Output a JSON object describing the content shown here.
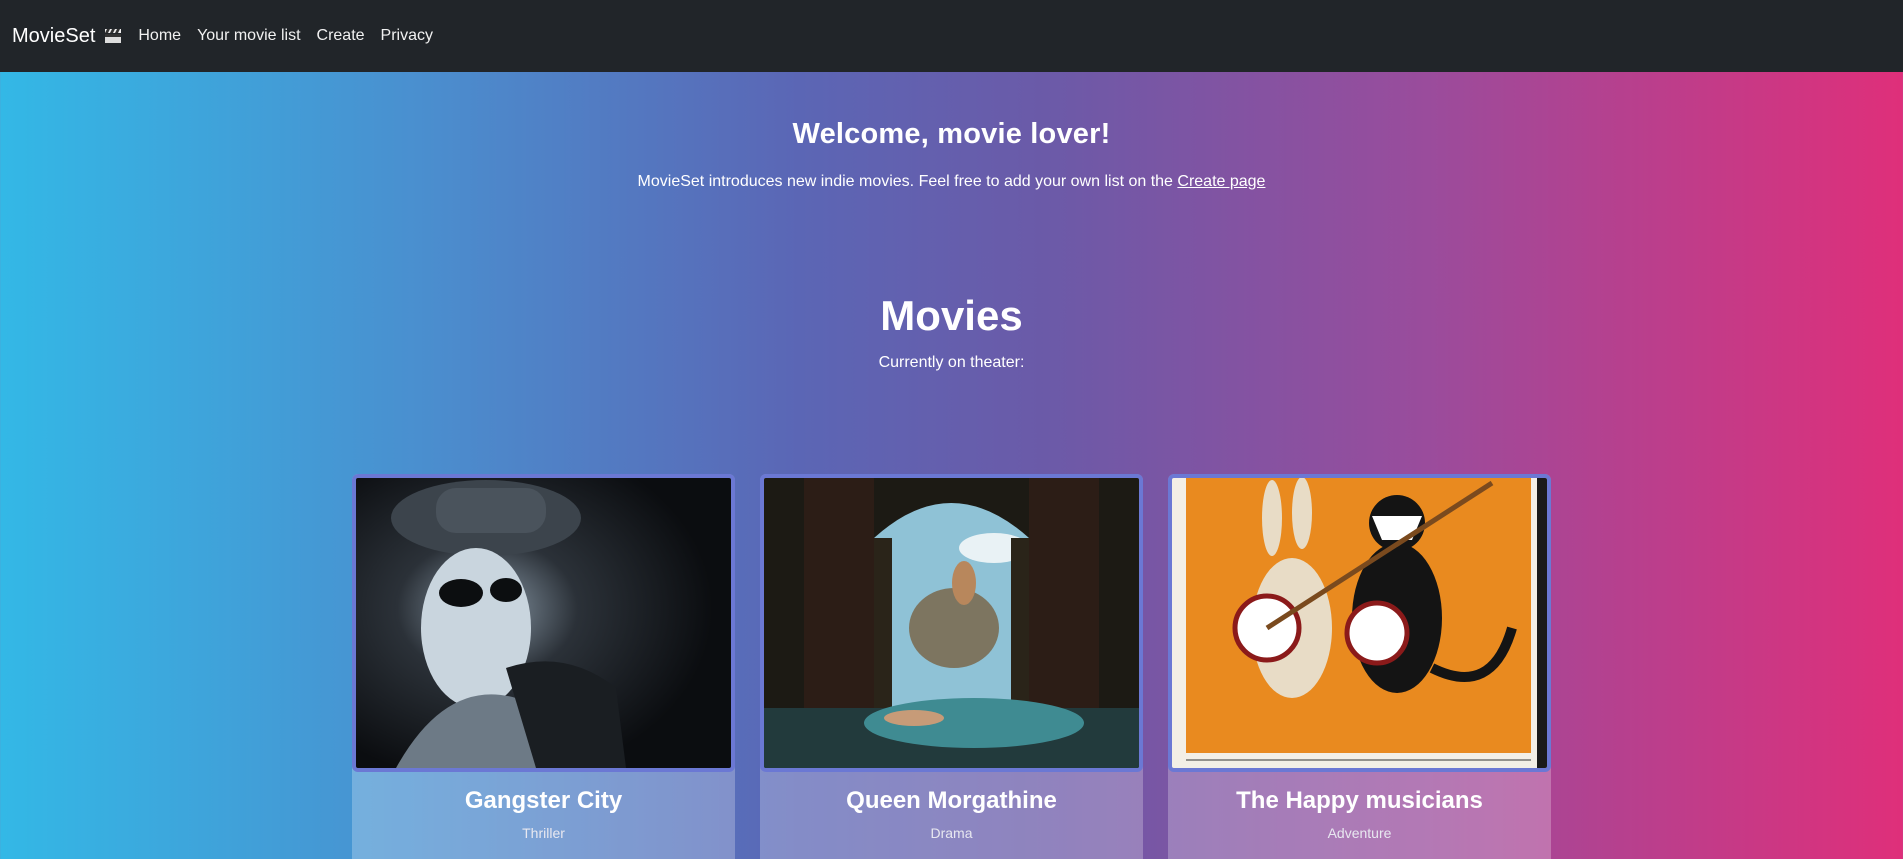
{
  "navbar": {
    "brand": "MovieSet",
    "brand_icon": "clapperboard-icon",
    "links": [
      "Home",
      "Your movie list",
      "Create",
      "Privacy"
    ]
  },
  "hero": {
    "title": "Welcome, movie lover!",
    "text": "MovieSet introduces new indie movies. Feel free to add your own list on the ",
    "link": "Create page"
  },
  "movies": {
    "title": "Movies",
    "subtitle": "Currently on theater:"
  },
  "cards": [
    {
      "title": "Gangster City",
      "genre": "Thriller"
    },
    {
      "title": "Queen Morgathine",
      "genre": "Drama"
    },
    {
      "title": "The Happy musicians",
      "genre": "Adventure"
    }
  ],
  "colors": {
    "navbar": "#212529",
    "gradient_start": "#33b8e6",
    "gradient_end": "#df2f7a",
    "card_border": "#6b78d4"
  }
}
